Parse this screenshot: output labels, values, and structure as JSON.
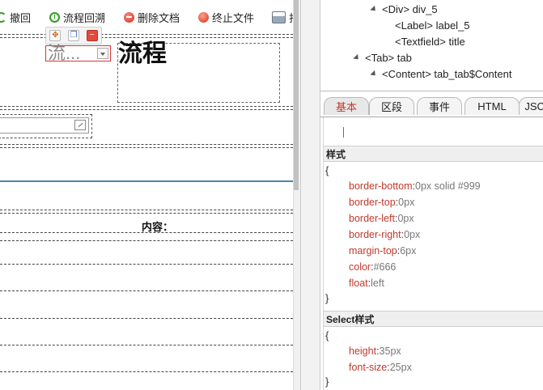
{
  "toolbar": {
    "undo_label": "撤回",
    "trace_label": "流程回溯",
    "delete_doc_label": "删除文档",
    "stop_file_label": "终止文件",
    "print_label": "打"
  },
  "canvas": {
    "select_value": "流...",
    "title_text": "流程",
    "content_label": "内容："
  },
  "tree": {
    "nodes": [
      {
        "label": "<Div> div_5"
      },
      {
        "label": "<Label> label_5"
      },
      {
        "label": "<Textfield> title"
      },
      {
        "label": "<Tab> tab"
      },
      {
        "label": "<Content> tab_tab$Content"
      }
    ]
  },
  "tabs": {
    "items": [
      {
        "label": "基本"
      },
      {
        "label": "区段"
      },
      {
        "label": "事件"
      },
      {
        "label": "HTML"
      },
      {
        "label": "JSO"
      }
    ],
    "active": "基本"
  },
  "styles": {
    "style_header": "样式",
    "open_brace": "{",
    "close_brace": "}",
    "rules": [
      {
        "prop": "border-bottom",
        "value": "0px solid #999"
      },
      {
        "prop": "border-top",
        "value": "0px"
      },
      {
        "prop": "border-left",
        "value": "0px"
      },
      {
        "prop": "border-right",
        "value": "0px"
      },
      {
        "prop": "margin-top",
        "value": "6px"
      },
      {
        "prop": "color",
        "value": "#666"
      },
      {
        "prop": "float",
        "value": "left"
      }
    ],
    "select_header": "Select样式",
    "select_rules": [
      {
        "prop": "height",
        "value": "35px"
      },
      {
        "prop": "font-size",
        "value": "25px"
      }
    ]
  },
  "colors": {
    "accent_red": "#c0392b",
    "tab_active_text": "#c5392a",
    "divider_blue": "#4a84a8"
  },
  "icons": {
    "undo": "undo-icon",
    "trace": "clock-icon",
    "delete": "delete-icon",
    "stop": "stop-icon",
    "print": "print-icon"
  }
}
